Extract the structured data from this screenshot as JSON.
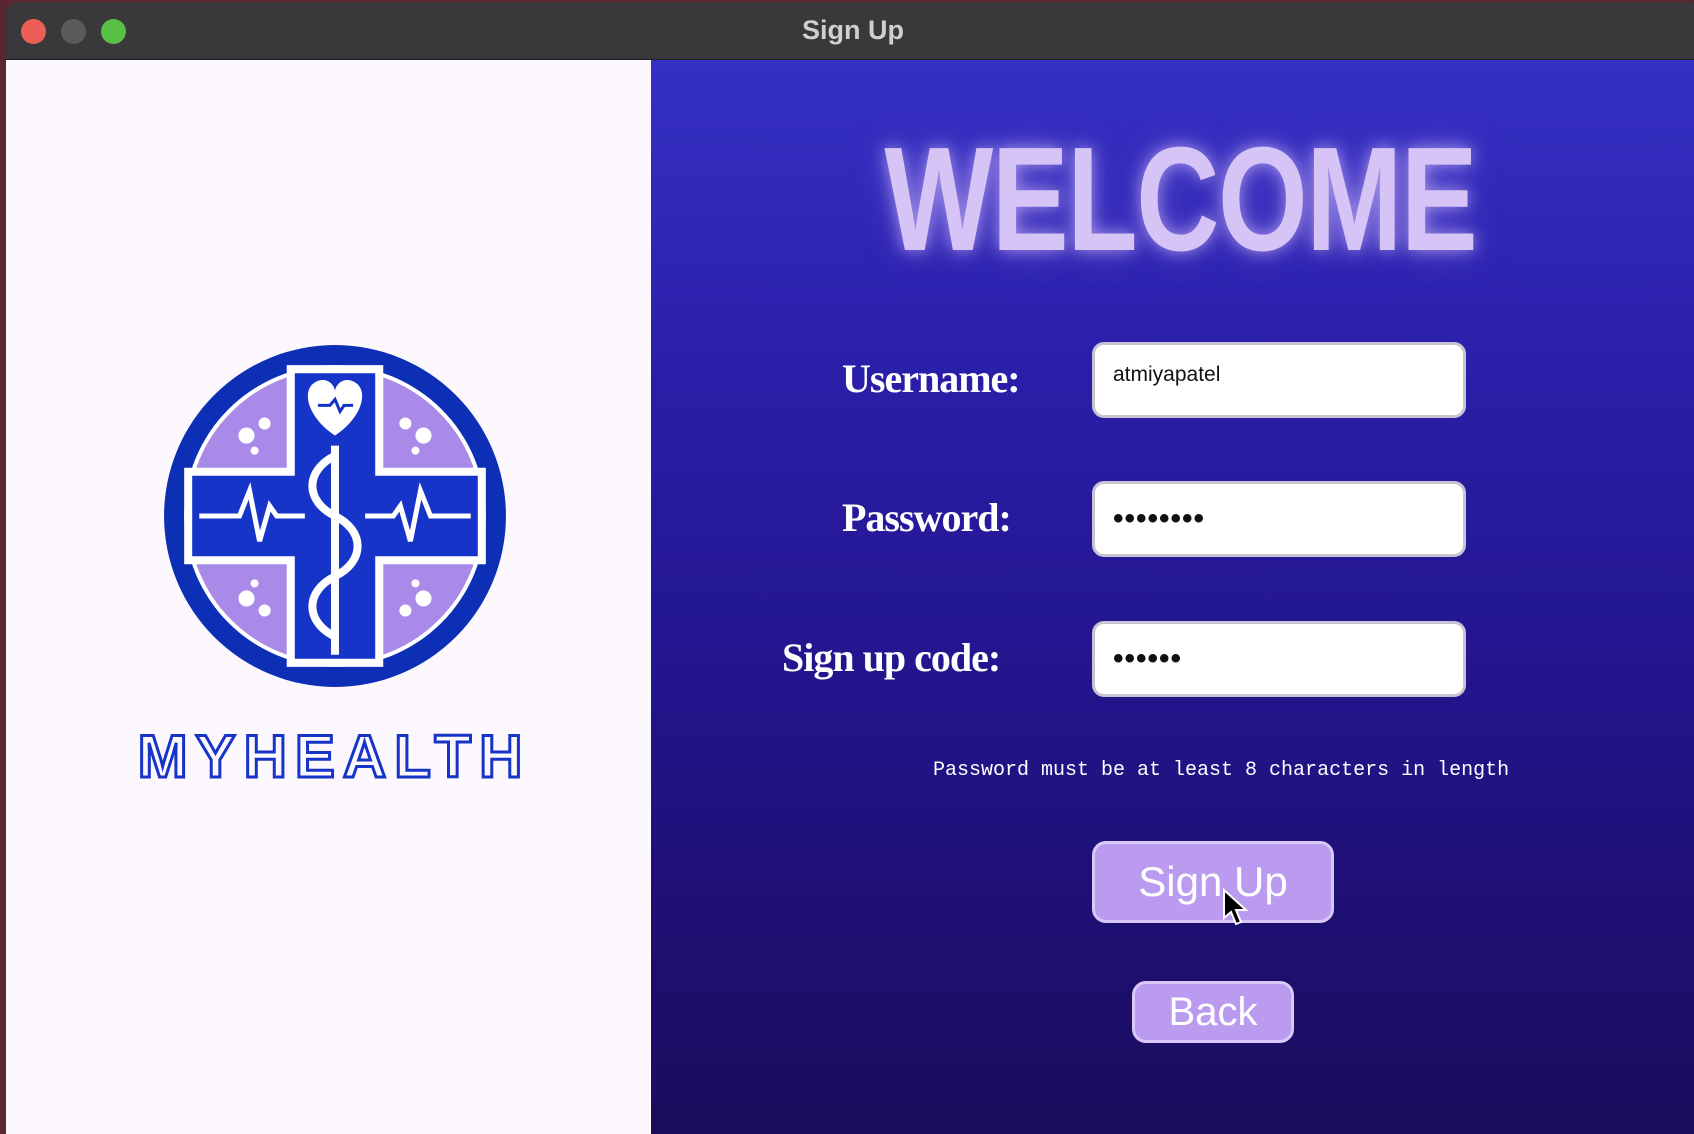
{
  "window": {
    "title": "Sign Up"
  },
  "brand": {
    "name": "MYHEALTH"
  },
  "welcome": {
    "heading": "WELCOME"
  },
  "form": {
    "username": {
      "label": "Username:",
      "value": "atmiyapatel"
    },
    "password": {
      "label": "Password:",
      "masked_value": "••••••••"
    },
    "signup_code": {
      "label": "Sign up code:",
      "masked_value": "••••••"
    },
    "hint": "Password must be at least 8 characters in length",
    "signup_label": "Sign Up",
    "back_label": "Back"
  },
  "icons": [
    "close-icon",
    "minimize-icon",
    "zoom-icon",
    "myhealth-logo-icon",
    "mouse-cursor-icon"
  ],
  "colors": {
    "panel_gradient_top": "#3530c4",
    "panel_gradient_bottom": "#1b0c5c",
    "button": "#bb9bf0",
    "welcome_text": "#d6c4f6",
    "logo_blue": "#0c2fb5",
    "logo_lavender": "#a98ae8"
  }
}
